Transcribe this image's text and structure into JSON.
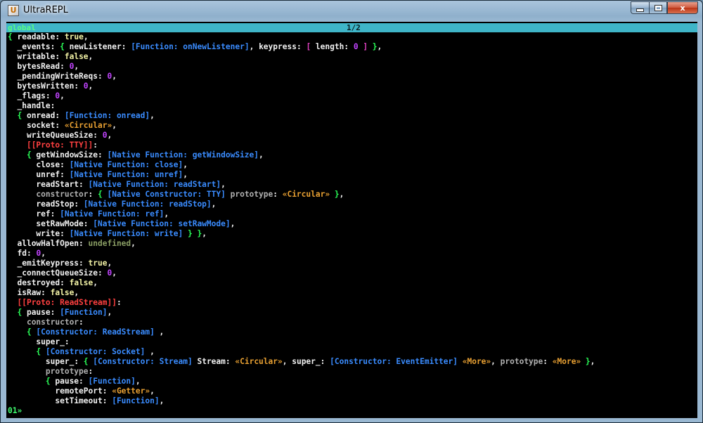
{
  "window": {
    "title": "UltraREPL",
    "icon": "app-icon",
    "controls": {
      "minimize": "minimize-icon",
      "maximize": "maximize-icon",
      "close_glyph": "x"
    }
  },
  "status": {
    "context": "global",
    "page": "1/2"
  },
  "colors": {
    "key": "#f2f2f2",
    "boolean": "#f3f3a6",
    "number": "#c244ff",
    "function": "#3a8cff",
    "circular": "#e8a032",
    "proto": "#ff4040",
    "undefined": "#8a9e64",
    "inherited": "#b0b0b0",
    "brace": "#2aff58",
    "bracket": "#e040c0",
    "status_bar": "#3fb5c8"
  },
  "output_lines": [
    [
      [
        "b",
        "{ "
      ],
      [
        "k",
        "readable"
      ],
      [
        "p",
        ": "
      ],
      [
        "t",
        "true"
      ],
      [
        "p",
        ","
      ]
    ],
    [
      [
        "p",
        "  "
      ],
      [
        "k",
        "_events"
      ],
      [
        "p",
        ": "
      ],
      [
        "b",
        "{ "
      ],
      [
        "k",
        "newListener"
      ],
      [
        "p",
        ": "
      ],
      [
        "f",
        "[Function: onNewListener]"
      ],
      [
        "p",
        ", "
      ],
      [
        "k",
        "keypress"
      ],
      [
        "p",
        ": "
      ],
      [
        "m",
        "[ "
      ],
      [
        "k",
        "length"
      ],
      [
        "p",
        ": "
      ],
      [
        "n",
        "0"
      ],
      [
        "m",
        " ]"
      ],
      [
        "b",
        " }"
      ],
      [
        "p",
        ","
      ]
    ],
    [
      [
        "p",
        "  "
      ],
      [
        "k",
        "writable"
      ],
      [
        "p",
        ": "
      ],
      [
        "t",
        "false"
      ],
      [
        "p",
        ","
      ]
    ],
    [
      [
        "p",
        "  "
      ],
      [
        "k",
        "bytesRead"
      ],
      [
        "p",
        ": "
      ],
      [
        "n",
        "0"
      ],
      [
        "p",
        ","
      ]
    ],
    [
      [
        "p",
        "  "
      ],
      [
        "k",
        "_pendingWriteReqs"
      ],
      [
        "p",
        ": "
      ],
      [
        "n",
        "0"
      ],
      [
        "p",
        ","
      ]
    ],
    [
      [
        "p",
        "  "
      ],
      [
        "k",
        "bytesWritten"
      ],
      [
        "p",
        ": "
      ],
      [
        "n",
        "0"
      ],
      [
        "p",
        ","
      ]
    ],
    [
      [
        "p",
        "  "
      ],
      [
        "k",
        "_flags"
      ],
      [
        "p",
        ": "
      ],
      [
        "n",
        "0"
      ],
      [
        "p",
        ","
      ]
    ],
    [
      [
        "p",
        "  "
      ],
      [
        "k",
        "_handle"
      ],
      [
        "p",
        ":"
      ]
    ],
    [
      [
        "b",
        "  { "
      ],
      [
        "k",
        "onread"
      ],
      [
        "p",
        ": "
      ],
      [
        "f",
        "[Function: onread]"
      ],
      [
        "p",
        ","
      ]
    ],
    [
      [
        "p",
        "    "
      ],
      [
        "k",
        "socket"
      ],
      [
        "p",
        ": "
      ],
      [
        "c",
        "«Circular»"
      ],
      [
        "p",
        ","
      ]
    ],
    [
      [
        "p",
        "    "
      ],
      [
        "k",
        "writeQueueSize"
      ],
      [
        "p",
        ": "
      ],
      [
        "n",
        "0"
      ],
      [
        "p",
        ","
      ]
    ],
    [
      [
        "p",
        "    "
      ],
      [
        "x",
        "[[Proto: TTY]]"
      ],
      [
        "p",
        ":"
      ]
    ],
    [
      [
        "b",
        "    { "
      ],
      [
        "k",
        "getWindowSize"
      ],
      [
        "p",
        ": "
      ],
      [
        "f",
        "[Native Function: getWindowSize]"
      ],
      [
        "p",
        ","
      ]
    ],
    [
      [
        "p",
        "      "
      ],
      [
        "k",
        "close"
      ],
      [
        "p",
        ": "
      ],
      [
        "f",
        "[Native Function: close]"
      ],
      [
        "p",
        ","
      ]
    ],
    [
      [
        "p",
        "      "
      ],
      [
        "k",
        "unref"
      ],
      [
        "p",
        ": "
      ],
      [
        "f",
        "[Native Function: unref]"
      ],
      [
        "p",
        ","
      ]
    ],
    [
      [
        "p",
        "      "
      ],
      [
        "k",
        "readStart"
      ],
      [
        "p",
        ": "
      ],
      [
        "f",
        "[Native Function: readStart]"
      ],
      [
        "p",
        ","
      ]
    ],
    [
      [
        "p",
        "      "
      ],
      [
        "g",
        "constructor"
      ],
      [
        "p",
        ": "
      ],
      [
        "b",
        "{ "
      ],
      [
        "f",
        "[Native Constructor: TTY]"
      ],
      [
        "g",
        " prototype"
      ],
      [
        "p",
        ": "
      ],
      [
        "c",
        "«Circular»"
      ],
      [
        "b",
        " }"
      ],
      [
        "p",
        ","
      ]
    ],
    [
      [
        "p",
        "      "
      ],
      [
        "k",
        "readStop"
      ],
      [
        "p",
        ": "
      ],
      [
        "f",
        "[Native Function: readStop]"
      ],
      [
        "p",
        ","
      ]
    ],
    [
      [
        "p",
        "      "
      ],
      [
        "k",
        "ref"
      ],
      [
        "p",
        ": "
      ],
      [
        "f",
        "[Native Function: ref]"
      ],
      [
        "p",
        ","
      ]
    ],
    [
      [
        "p",
        "      "
      ],
      [
        "k",
        "setRawMode"
      ],
      [
        "p",
        ": "
      ],
      [
        "f",
        "[Native Function: setRawMode]"
      ],
      [
        "p",
        ","
      ]
    ],
    [
      [
        "p",
        "      "
      ],
      [
        "k",
        "write"
      ],
      [
        "p",
        ": "
      ],
      [
        "f",
        "[Native Function: write]"
      ],
      [
        "b",
        " } }"
      ],
      [
        "p",
        ","
      ]
    ],
    [
      [
        "p",
        "  "
      ],
      [
        "k",
        "allowHalfOpen"
      ],
      [
        "p",
        ": "
      ],
      [
        "u",
        "undefined"
      ],
      [
        "p",
        ","
      ]
    ],
    [
      [
        "p",
        "  "
      ],
      [
        "k",
        "fd"
      ],
      [
        "p",
        ": "
      ],
      [
        "n",
        "0"
      ],
      [
        "p",
        ","
      ]
    ],
    [
      [
        "p",
        "  "
      ],
      [
        "k",
        "_emitKeypress"
      ],
      [
        "p",
        ": "
      ],
      [
        "t",
        "true"
      ],
      [
        "p",
        ","
      ]
    ],
    [
      [
        "p",
        "  "
      ],
      [
        "k",
        "_connectQueueSize"
      ],
      [
        "p",
        ": "
      ],
      [
        "n",
        "0"
      ],
      [
        "p",
        ","
      ]
    ],
    [
      [
        "p",
        "  "
      ],
      [
        "k",
        "destroyed"
      ],
      [
        "p",
        ": "
      ],
      [
        "t",
        "false"
      ],
      [
        "p",
        ","
      ]
    ],
    [
      [
        "p",
        "  "
      ],
      [
        "k",
        "isRaw"
      ],
      [
        "p",
        ": "
      ],
      [
        "t",
        "false"
      ],
      [
        "p",
        ","
      ]
    ],
    [
      [
        "p",
        "  "
      ],
      [
        "x",
        "[[Proto: ReadStream]]"
      ],
      [
        "p",
        ":"
      ]
    ],
    [
      [
        "b",
        "  { "
      ],
      [
        "k",
        "pause"
      ],
      [
        "p",
        ": "
      ],
      [
        "f",
        "[Function]"
      ],
      [
        "p",
        ","
      ]
    ],
    [
      [
        "p",
        "    "
      ],
      [
        "g",
        "constructor"
      ],
      [
        "p",
        ":"
      ]
    ],
    [
      [
        "b",
        "    { "
      ],
      [
        "f",
        "[Constructor: ReadStream]"
      ],
      [
        "p",
        " ,"
      ]
    ],
    [
      [
        "p",
        "      "
      ],
      [
        "k",
        "super_"
      ],
      [
        "p",
        ":"
      ]
    ],
    [
      [
        "b",
        "      { "
      ],
      [
        "f",
        "[Constructor: Socket]"
      ],
      [
        "p",
        " ,"
      ]
    ],
    [
      [
        "p",
        "        "
      ],
      [
        "k",
        "super_"
      ],
      [
        "p",
        ": "
      ],
      [
        "b",
        "{ "
      ],
      [
        "f",
        "[Constructor: Stream]"
      ],
      [
        "k",
        " Stream"
      ],
      [
        "p",
        ": "
      ],
      [
        "c",
        "«Circular»"
      ],
      [
        "p",
        ", "
      ],
      [
        "k",
        "super_"
      ],
      [
        "p",
        ": "
      ],
      [
        "f",
        "[Constructor: EventEmitter]"
      ],
      [
        "p",
        " "
      ],
      [
        "c",
        "«More»"
      ],
      [
        "p",
        ", "
      ],
      [
        "g",
        "prototype"
      ],
      [
        "p",
        ": "
      ],
      [
        "c",
        "«More»"
      ],
      [
        "b",
        " }"
      ],
      [
        "p",
        ","
      ]
    ],
    [
      [
        "p",
        "        "
      ],
      [
        "g",
        "prototype"
      ],
      [
        "p",
        ":"
      ]
    ],
    [
      [
        "b",
        "        { "
      ],
      [
        "k",
        "pause"
      ],
      [
        "p",
        ": "
      ],
      [
        "f",
        "[Function]"
      ],
      [
        "p",
        ","
      ]
    ],
    [
      [
        "p",
        "          "
      ],
      [
        "k",
        "remotePort"
      ],
      [
        "p",
        ": "
      ],
      [
        "c",
        "«Getter»"
      ],
      [
        "p",
        ","
      ]
    ],
    [
      [
        "p",
        "          "
      ],
      [
        "k",
        "setTimeout"
      ],
      [
        "p",
        ": "
      ],
      [
        "f",
        "[Function]"
      ],
      [
        "p",
        ","
      ]
    ]
  ],
  "prompt": "01»"
}
